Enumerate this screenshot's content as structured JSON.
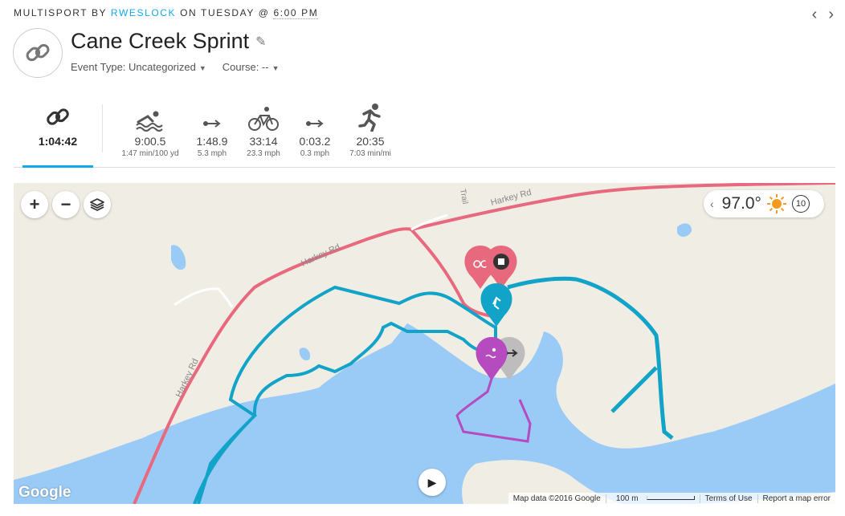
{
  "header": {
    "sport": "MULTISPORT",
    "by": "BY",
    "user": "RWESLOCK",
    "on": "ON TUESDAY @",
    "time": "6:00 PM"
  },
  "nav": {
    "prev": "‹",
    "next": "›"
  },
  "activity": {
    "title": "Cane Creek Sprint",
    "event_type_label": "Event Type: Uncategorized",
    "course_label": "Course: --"
  },
  "stats": {
    "total": "1:04:42",
    "legs": [
      {
        "icon": "swim-icon",
        "value": "9:00.5",
        "sub": "1:47 min/100 yd"
      },
      {
        "icon": "transition-icon",
        "value": "1:48.9",
        "sub": "5.3 mph"
      },
      {
        "icon": "bike-icon",
        "value": "33:14",
        "sub": "23.3 mph"
      },
      {
        "icon": "transition-icon",
        "value": "0:03.2",
        "sub": "0.3 mph"
      },
      {
        "icon": "run-icon",
        "value": "20:35",
        "sub": "7:03 min/mi"
      }
    ]
  },
  "map": {
    "zoom_in": "+",
    "zoom_out": "−",
    "temperature": "97.0°",
    "wind": "10",
    "road_labels": [
      "Harkey Rd",
      "Harkey Rd",
      "Harkey Rd",
      "Trail"
    ],
    "google": "Google",
    "attribution": {
      "map_data": "Map data ©2016 Google",
      "scale": "100 m",
      "terms": "Terms of Use",
      "report": "Report a map error"
    },
    "colors": {
      "water": "#9acbf7",
      "road": "#e8687e",
      "bike_route": "#11a3c8",
      "swim_route": "#b54bbf",
      "accent": "#11a9ed"
    }
  }
}
